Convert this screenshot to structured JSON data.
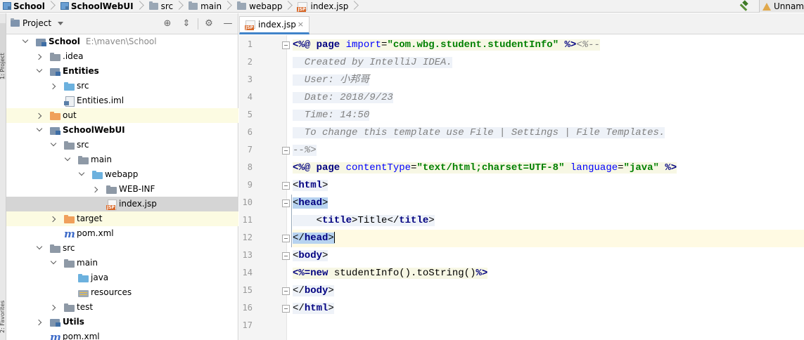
{
  "breadcrumb": [
    {
      "label": "School",
      "icon": "module-icon",
      "bold": true
    },
    {
      "label": "SchoolWebUI",
      "icon": "module-icon",
      "bold": true
    },
    {
      "label": "src",
      "icon": "folder-icon",
      "bold": false
    },
    {
      "label": "main",
      "icon": "folder-icon",
      "bold": false
    },
    {
      "label": "webapp",
      "icon": "folder-icon",
      "bold": false
    },
    {
      "label": "index.jsp",
      "icon": "jsp-file-icon",
      "bold": false
    }
  ],
  "toolbar": {
    "build_icon": "hammer-icon",
    "run_config_label": "Unnam"
  },
  "tool_strip": {
    "project_tab": "1: Project",
    "favorites_tab": "2: Favorites"
  },
  "project_panel": {
    "title": "Project",
    "icons": [
      "globe-icon",
      "collapse-icon",
      "gear-icon",
      "minimize-icon"
    ]
  },
  "tree": [
    {
      "label": "School",
      "path": "E:\\maven\\School",
      "icon": "module-folder-icon",
      "arrow": "open",
      "bold": true,
      "state": ""
    },
    {
      "label": ".idea",
      "icon": "folder-icon",
      "arrow": "closed",
      "bold": false,
      "state": ""
    },
    {
      "label": "Entities",
      "icon": "module-folder-icon",
      "arrow": "open",
      "bold": true,
      "state": ""
    },
    {
      "label": "src",
      "icon": "source-folder-icon",
      "arrow": "closed",
      "bold": false,
      "state": ""
    },
    {
      "label": "Entities.iml",
      "icon": "iml-file-icon",
      "arrow": "",
      "bold": false,
      "state": ""
    },
    {
      "label": "out",
      "icon": "excluded-folder-icon",
      "arrow": "closed",
      "bold": false,
      "state": "excluded"
    },
    {
      "label": "SchoolWebUI",
      "icon": "module-folder-icon",
      "arrow": "open",
      "bold": true,
      "state": ""
    },
    {
      "label": "src",
      "icon": "folder-icon",
      "arrow": "open",
      "bold": false,
      "state": ""
    },
    {
      "label": "main",
      "icon": "folder-icon",
      "arrow": "open",
      "bold": false,
      "state": ""
    },
    {
      "label": "webapp",
      "icon": "web-folder-icon",
      "arrow": "open",
      "bold": false,
      "state": ""
    },
    {
      "label": "WEB-INF",
      "icon": "folder-icon",
      "arrow": "closed",
      "bold": false,
      "state": ""
    },
    {
      "label": "index.jsp",
      "icon": "jsp-file-icon",
      "arrow": "",
      "bold": false,
      "state": "selected"
    },
    {
      "label": "target",
      "icon": "excluded-folder-icon",
      "arrow": "closed",
      "bold": false,
      "state": "excluded"
    },
    {
      "label": "pom.xml",
      "icon": "maven-icon",
      "arrow": "",
      "bold": false,
      "state": ""
    },
    {
      "label": "src",
      "icon": "folder-icon",
      "arrow": "open",
      "bold": false,
      "state": ""
    },
    {
      "label": "main",
      "icon": "folder-icon",
      "arrow": "open",
      "bold": false,
      "state": ""
    },
    {
      "label": "java",
      "icon": "source-folder-icon",
      "arrow": "",
      "bold": false,
      "state": ""
    },
    {
      "label": "resources",
      "icon": "resources-folder-icon",
      "arrow": "",
      "bold": false,
      "state": ""
    },
    {
      "label": "test",
      "icon": "folder-icon",
      "arrow": "closed",
      "bold": false,
      "state": ""
    },
    {
      "label": "Utils",
      "icon": "module-folder-icon",
      "arrow": "closed",
      "bold": true,
      "state": ""
    },
    {
      "label": "pom.xml",
      "icon": "maven-icon",
      "arrow": "",
      "bold": false,
      "state": ""
    }
  ],
  "editor": {
    "tab_label": "index.jsp",
    "tab_icon": "jsp-file-icon",
    "close_icon": "close-icon",
    "current_line": 12,
    "lines": [
      {
        "n": "1",
        "tokens": [
          [
            "k",
            "<%@ page "
          ],
          [
            "a",
            "import"
          ],
          [
            "t",
            "="
          ],
          [
            "s",
            "\"com.wbg.student.studentInfo\""
          ],
          [
            "t",
            " "
          ],
          [
            "k",
            "%>"
          ],
          [
            "c",
            "<%--"
          ]
        ]
      },
      {
        "n": "2",
        "tokens": [
          [
            "c",
            "  Created by IntelliJ IDEA."
          ]
        ]
      },
      {
        "n": "3",
        "tokens": [
          [
            "c",
            "  User: 小邦哥"
          ]
        ]
      },
      {
        "n": "4",
        "tokens": [
          [
            "c",
            "  Date: 2018/9/23"
          ]
        ]
      },
      {
        "n": "5",
        "tokens": [
          [
            "c",
            "  Time: 14:50"
          ]
        ]
      },
      {
        "n": "6",
        "tokens": [
          [
            "c",
            "  To change this template use File | Settings | File Templates."
          ]
        ]
      },
      {
        "n": "7",
        "tokens": [
          [
            "c",
            "--%>"
          ]
        ]
      },
      {
        "n": "8",
        "tokens": [
          [
            "k",
            "<%@ page "
          ],
          [
            "a",
            "contentType"
          ],
          [
            "t",
            "="
          ],
          [
            "s",
            "\"text/html;charset=UTF-8\""
          ],
          [
            "t",
            " "
          ],
          [
            "a",
            "language"
          ],
          [
            "t",
            "="
          ],
          [
            "s",
            "\"java\""
          ],
          [
            "t",
            " "
          ],
          [
            "k",
            "%>"
          ]
        ]
      },
      {
        "n": "9",
        "tokens": [
          [
            "t",
            "<"
          ],
          [
            "tag",
            "html"
          ],
          [
            "t",
            ">"
          ]
        ]
      },
      {
        "n": "10",
        "tokens": [
          [
            "t",
            "<"
          ],
          [
            "tag",
            "head"
          ],
          [
            "t",
            ">"
          ]
        ]
      },
      {
        "n": "11",
        "tokens": [
          [
            "t",
            "    <"
          ],
          [
            "tag",
            "title"
          ],
          [
            "t",
            ">Title</"
          ],
          [
            "tag",
            "title"
          ],
          [
            "t",
            ">"
          ]
        ]
      },
      {
        "n": "12",
        "tokens": [
          [
            "t",
            "</"
          ],
          [
            "tag",
            "head"
          ],
          [
            "t",
            ">"
          ]
        ]
      },
      {
        "n": "13",
        "tokens": [
          [
            "t",
            "<"
          ],
          [
            "tag",
            "body"
          ],
          [
            "t",
            ">"
          ]
        ]
      },
      {
        "n": "14",
        "tokens": [
          [
            "k",
            "<%="
          ],
          [
            "k",
            "new"
          ],
          [
            "t",
            " studentInfo().toString()"
          ],
          [
            "k",
            "%>"
          ]
        ]
      },
      {
        "n": "15",
        "tokens": [
          [
            "t",
            "</"
          ],
          [
            "tag",
            "body"
          ],
          [
            "t",
            ">"
          ]
        ]
      },
      {
        "n": "16",
        "tokens": [
          [
            "t",
            "</"
          ],
          [
            "tag",
            "html"
          ],
          [
            "t",
            ">"
          ]
        ]
      },
      {
        "n": "17",
        "tokens": []
      }
    ]
  }
}
